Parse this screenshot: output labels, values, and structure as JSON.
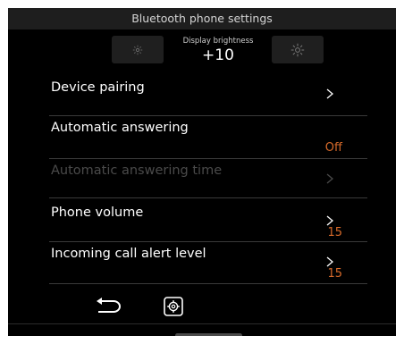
{
  "header": {
    "title": "Bluetooth phone settings"
  },
  "brightness": {
    "caption": "Display brightness",
    "value": "+10",
    "decrease_icon": "sun-dim-icon",
    "increase_icon": "sun-bright-icon"
  },
  "settings": [
    {
      "label": "Device pairing",
      "value": "",
      "enabled": true
    },
    {
      "label": "Automatic answering",
      "value": "Off",
      "enabled": true
    },
    {
      "label": "Automatic answering time",
      "value": "",
      "enabled": false
    },
    {
      "label": "Phone volume",
      "value": "15",
      "enabled": true
    },
    {
      "label": "Incoming call alert level",
      "value": "15",
      "enabled": true
    }
  ],
  "footer": {
    "back_icon": "back-arrow-icon",
    "settings_icon": "gear-icon"
  },
  "colors": {
    "value_accent": "#d76a2a",
    "background": "#000000",
    "title_bar": "#1e1e1e"
  }
}
